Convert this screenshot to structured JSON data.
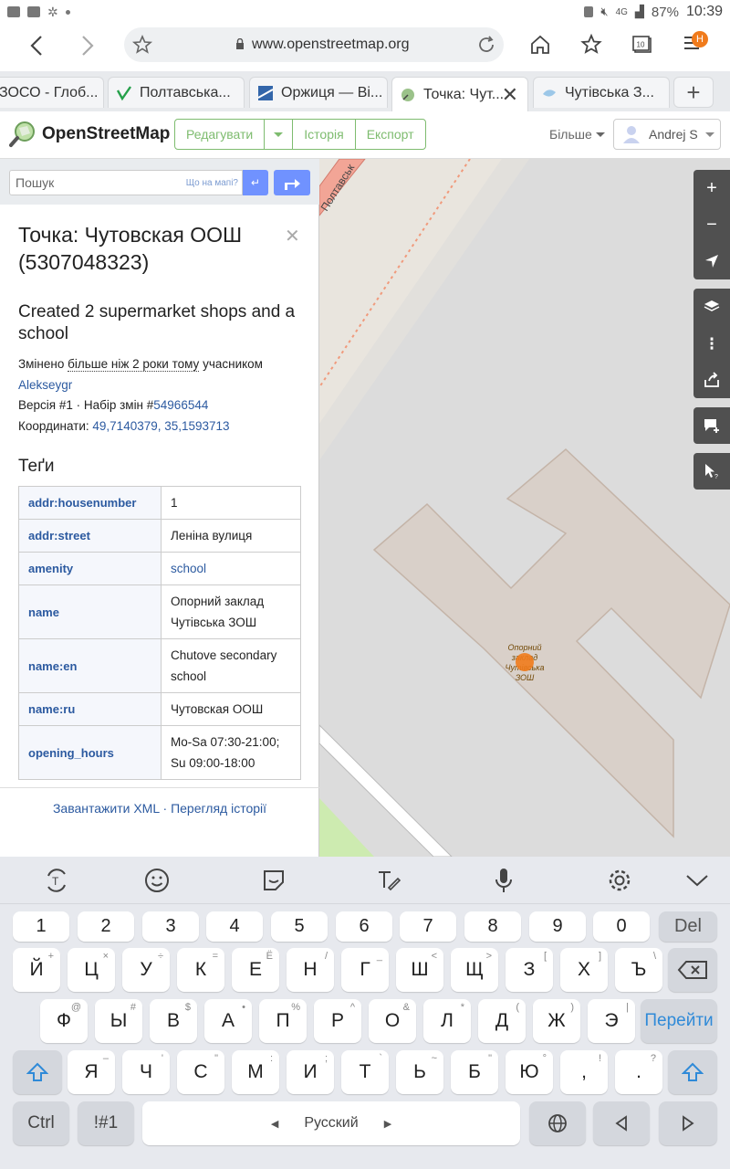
{
  "status_bar": {
    "battery": "87%",
    "time": "10:39",
    "network": "4G"
  },
  "browser": {
    "url": "www.openstreetmap.org",
    "tabs": [
      {
        "label": "ЗОСО - Глоб..."
      },
      {
        "label": "Полтавська..."
      },
      {
        "label": "Оржиця — Ві..."
      },
      {
        "label": "Точка: Чут..."
      },
      {
        "label": "Чутівська З..."
      }
    ],
    "notification_badge": "Н"
  },
  "osm_header": {
    "logo": "OpenStreetMap",
    "edit_label": "Редагувати",
    "history_label": "Історія",
    "export_label": "Експорт",
    "more_label": "Більше",
    "user_name": "Andrej S"
  },
  "search": {
    "placeholder": "Пошук",
    "whats_here": "Що на мапі?",
    "go_symbol": "↵"
  },
  "feature": {
    "title": "Точка: Чутовская ООШ (5307048323)",
    "changeset_comment": "Created 2 supermarket shops and a school",
    "edited_prefix": "Змінено",
    "edited_when": "більше ніж 2 роки тому",
    "edited_by_prefix": "учасником",
    "user": "Alekseygr",
    "version_prefix": "Версія #1 · Набір змін #",
    "changeset_id": "54966544",
    "coords_prefix": "Координати:",
    "coords": "49,7140379, 35,1593713",
    "tags_title": "Теґи",
    "tags": [
      {
        "key": "addr:housenumber",
        "value": "1"
      },
      {
        "key": "addr:street",
        "value": "Леніна вулиця"
      },
      {
        "key": "amenity",
        "value": "school"
      },
      {
        "key": "name",
        "value": "Опорний заклад Чутівська ЗОШ"
      },
      {
        "key": "name:en",
        "value": "Chutove secondary school"
      },
      {
        "key": "name:ru",
        "value": "Чутовская ООШ"
      },
      {
        "key": "opening_hours",
        "value": "Mo-Sa 07:30-21:00; Su 09:00-18:00"
      }
    ],
    "download_xml": "Завантажити XML",
    "view_history": "Перегляд історії"
  },
  "map": {
    "street_label": "Полтавськ",
    "poi_label": "Опорний заклад Чутівська ЗОШ",
    "marker_color": "#f07b1c",
    "building_color": "#d9d0c9"
  },
  "keyboard": {
    "numbers": [
      "1",
      "2",
      "3",
      "4",
      "5",
      "6",
      "7",
      "8",
      "9",
      "0"
    ],
    "del": "Del",
    "row1": [
      {
        "k": "Й",
        "h": "+"
      },
      {
        "k": "Ц",
        "h": "×"
      },
      {
        "k": "У",
        "h": "÷"
      },
      {
        "k": "К",
        "h": "="
      },
      {
        "k": "Е",
        "h": "Ё"
      },
      {
        "k": "Н",
        "h": "/"
      },
      {
        "k": "Г",
        "h": "_"
      },
      {
        "k": "Ш",
        "h": "<"
      },
      {
        "k": "Щ",
        "h": ">"
      },
      {
        "k": "З",
        "h": "["
      },
      {
        "k": "Х",
        "h": "]"
      },
      {
        "k": "Ъ",
        "h": "\\"
      }
    ],
    "row2": [
      {
        "k": "Ф",
        "h": "@"
      },
      {
        "k": "Ы",
        "h": "#"
      },
      {
        "k": "В",
        "h": "$"
      },
      {
        "k": "А",
        "h": "•"
      },
      {
        "k": "П",
        "h": "%"
      },
      {
        "k": "Р",
        "h": "^"
      },
      {
        "k": "О",
        "h": "&"
      },
      {
        "k": "Л",
        "h": "*"
      },
      {
        "k": "Д",
        "h": "("
      },
      {
        "k": "Ж",
        "h": ")"
      },
      {
        "k": "Э",
        "h": "|"
      }
    ],
    "go_label": "Перейти",
    "row3": [
      {
        "k": "Я",
        "h": "–"
      },
      {
        "k": "Ч",
        "h": "'"
      },
      {
        "k": "С",
        "h": "\""
      },
      {
        "k": "М",
        "h": ":"
      },
      {
        "k": "И",
        "h": ";"
      },
      {
        "k": "Т",
        "h": "`"
      },
      {
        "k": "Ь",
        "h": "~"
      },
      {
        "k": "Б",
        "h": "\""
      },
      {
        "k": "Ю",
        "h": "°"
      },
      {
        "k": ",",
        "h": "!"
      },
      {
        "k": ".",
        "h": "?"
      }
    ],
    "ctrl": "Ctrl",
    "symbols": "!#1",
    "space": "Русский"
  }
}
